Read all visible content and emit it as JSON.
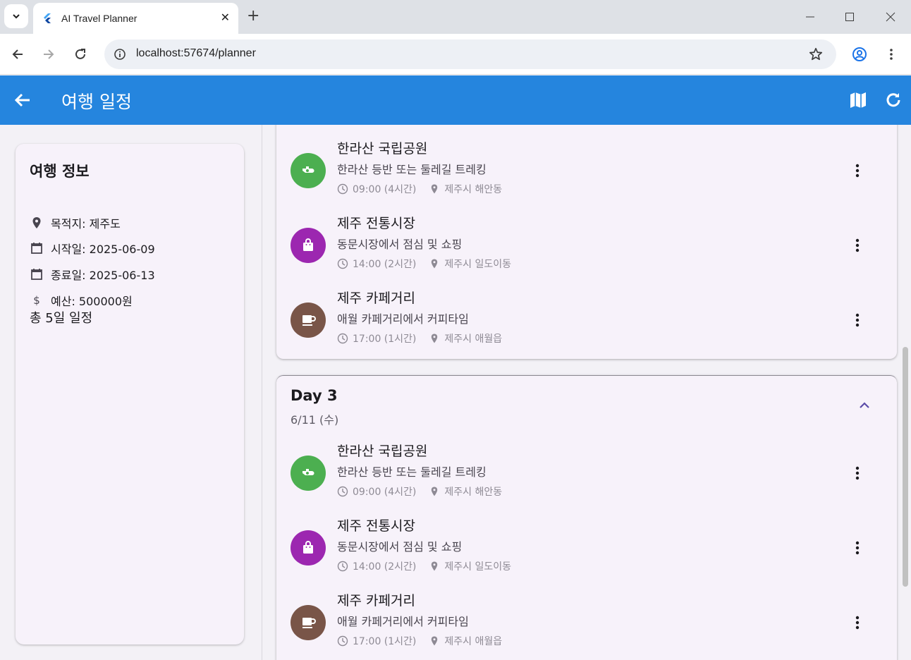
{
  "browser": {
    "tab_title": "AI Travel Planner",
    "url": "localhost:57674/planner"
  },
  "appbar": {
    "title": "여행 일정"
  },
  "trip_info": {
    "title": "여행 정보",
    "destination": "목적지: 제주도",
    "start_date": "시작일: 2025-06-09",
    "end_date": "종료일: 2025-06-13",
    "budget": "예산: 500000원",
    "total": "총 5일 일정"
  },
  "days": [
    {
      "activities": [
        {
          "name": "한라산 국립공원",
          "desc": "한라산 등반 또는 둘레길 트레킹",
          "time": "09:00 (4시간)",
          "place": "제주시 해안동",
          "icon": "hiking-icon",
          "color": "#4caf50"
        },
        {
          "name": "제주 전통시장",
          "desc": "동문시장에서 점심 및 쇼핑",
          "time": "14:00 (2시간)",
          "place": "제주시 일도이동",
          "icon": "shopping-bag-icon",
          "color": "#9c27b0"
        },
        {
          "name": "제주 카페거리",
          "desc": "애월 카페거리에서 커피타임",
          "time": "17:00 (1시간)",
          "place": "제주시 애월읍",
          "icon": "coffee-icon",
          "color": "#795548"
        }
      ]
    },
    {
      "title": "Day 3",
      "date": "6/11 (수)",
      "activities": [
        {
          "name": "한라산 국립공원",
          "desc": "한라산 등반 또는 둘레길 트레킹",
          "time": "09:00 (4시간)",
          "place": "제주시 해안동",
          "icon": "hiking-icon",
          "color": "#4caf50"
        },
        {
          "name": "제주 전통시장",
          "desc": "동문시장에서 점심 및 쇼핑",
          "time": "14:00 (2시간)",
          "place": "제주시 일도이동",
          "icon": "shopping-bag-icon",
          "color": "#9c27b0"
        },
        {
          "name": "제주 카페거리",
          "desc": "애월 카페거리에서 커피타임",
          "time": "17:00 (1시간)",
          "place": "제주시 애월읍",
          "icon": "coffee-icon",
          "color": "#795548"
        }
      ]
    }
  ]
}
